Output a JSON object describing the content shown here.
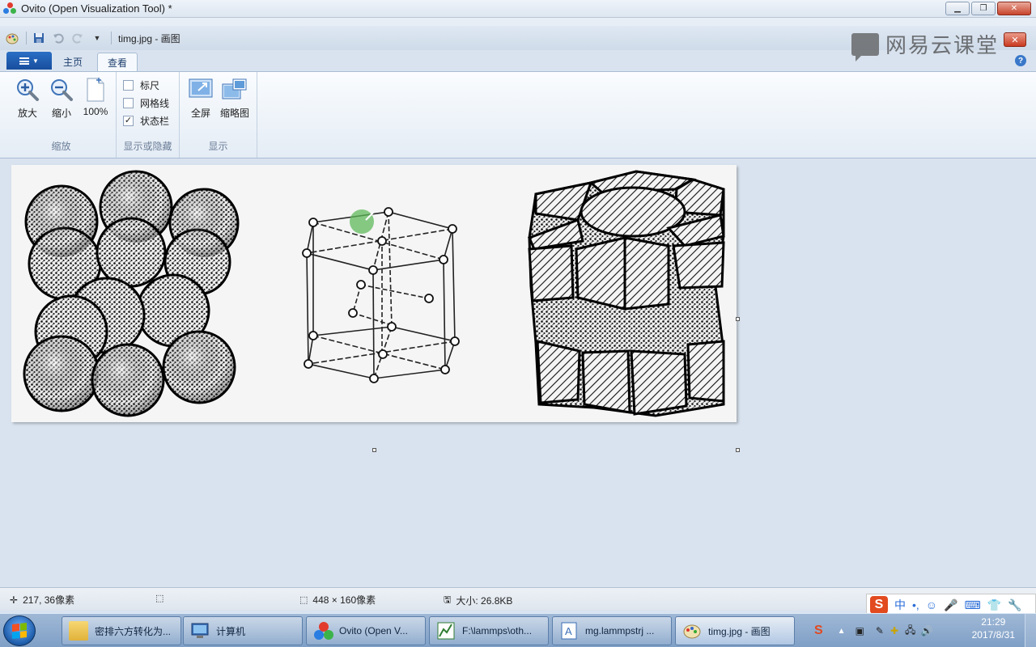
{
  "ovito": {
    "title": "Ovito (Open Visualization Tool) *"
  },
  "paint": {
    "doc_title": "timg.jpg - 画图",
    "watermark": "网易云课堂",
    "tabs": {
      "home": "主页",
      "view": "查看"
    },
    "zoom_group": {
      "label": "缩放",
      "zoom_in": "放大",
      "zoom_out": "缩小",
      "actual_size": "100%"
    },
    "show_group": {
      "label": "显示或隐藏",
      "ruler": "标尺",
      "gridlines": "网格线",
      "statusbar": "状态栏",
      "ruler_checked": false,
      "gridlines_checked": false,
      "statusbar_checked": true
    },
    "display_group": {
      "label": "显示",
      "fullscreen": "全屏",
      "thumbnail": "缩略图"
    },
    "status": {
      "cursor_pos": "217, 36像素",
      "selection_size": "448 × 160像素",
      "file_size": "大小: 26.8KB"
    }
  },
  "taskbar": {
    "items": [
      {
        "label": "密排六方转化为..."
      },
      {
        "label": "计算机"
      },
      {
        "label": "Ovito (Open V..."
      },
      {
        "label": "F:\\lammps\\oth..."
      },
      {
        "label": "mg.lammpstrj ..."
      },
      {
        "label": "timg.jpg - 画图"
      }
    ],
    "time": "21:29",
    "date": "2017/8/31"
  },
  "ime": {
    "lang": "中"
  }
}
